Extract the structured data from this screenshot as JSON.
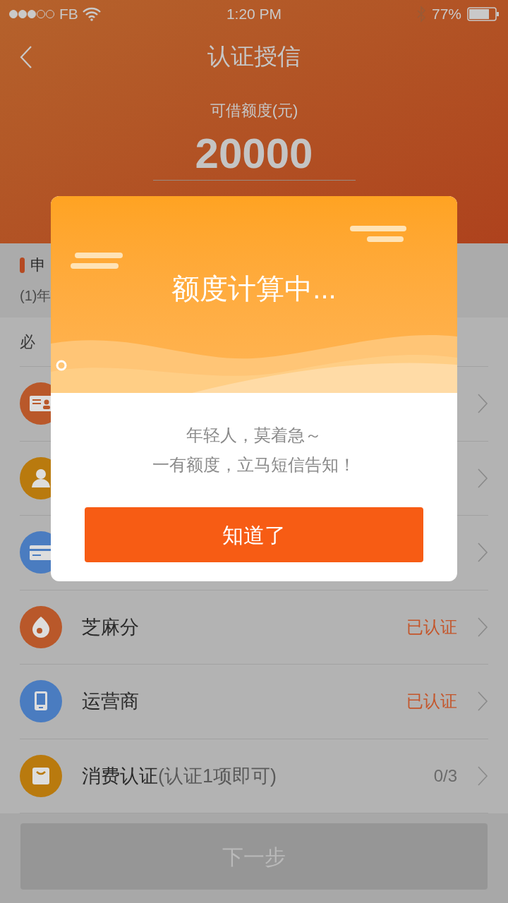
{
  "status_bar": {
    "carrier": "FB",
    "time": "1:20 PM",
    "battery": "77%"
  },
  "nav": {
    "title": "认证授信"
  },
  "credit": {
    "label": "可借额度(元)",
    "amount": "20000"
  },
  "notice": {
    "title": "申",
    "text": "(1)年"
  },
  "required_section": {
    "label": "必"
  },
  "items": [
    {
      "kind": "id_card",
      "color": "#b9582a"
    },
    {
      "kind": "person",
      "color": "#b97a0e"
    },
    {
      "kind": "bank_card",
      "color": "#4a7cc0"
    },
    {
      "kind": "sesame",
      "color": "#b9582a",
      "name": "芝麻分",
      "status": "已认证",
      "done": true
    },
    {
      "kind": "phone",
      "color": "#4a7cc0",
      "name": "运营商",
      "status": "已认证",
      "done": true
    },
    {
      "kind": "bag",
      "color": "#b97a0e",
      "name": "消费认证",
      "note": "(认证1项即可)",
      "status": "0/3",
      "done": false
    }
  ],
  "next_button": {
    "label": "下一步",
    "disabled": true
  },
  "modal": {
    "title": "额度计算中...",
    "message_lines": [
      "年轻人，莫着急～",
      "一有额度，立马短信告知！"
    ],
    "button": "知道了"
  }
}
